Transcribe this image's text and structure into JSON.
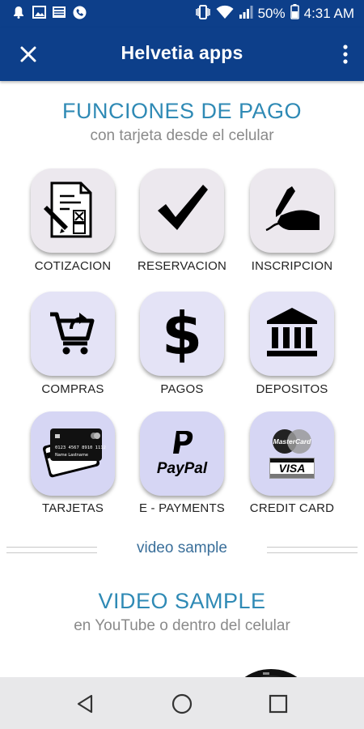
{
  "status_bar": {
    "battery": "50%",
    "time": "4:31 AM",
    "icons": [
      "notification-bell-icon",
      "image-icon",
      "news-icon",
      "phone-icon",
      "vibrate-icon",
      "wifi-icon",
      "signal-icon",
      "battery-icon"
    ]
  },
  "app_bar": {
    "title": "Helvetia apps",
    "close_icon": "close-icon",
    "menu_icon": "more-vert-icon"
  },
  "section1": {
    "title": "FUNCIONES DE PAGO",
    "subtitle": "con tarjeta desde el celular"
  },
  "tiles": [
    {
      "label": "COTIZACION",
      "icon": "quote-document-icon"
    },
    {
      "label": "RESERVACION",
      "icon": "checkmark-icon"
    },
    {
      "label": "INSCRIPCION",
      "icon": "signature-hand-icon"
    },
    {
      "label": "COMPRAS",
      "icon": "shopping-cart-icon"
    },
    {
      "label": "PAGOS",
      "icon": "dollar-icon"
    },
    {
      "label": "DEPOSITOS",
      "icon": "bank-icon"
    },
    {
      "label": "TARJETAS",
      "icon": "credit-cards-icon",
      "card_number": "0123 4567 8910 1112",
      "card_name": "Name Lastname"
    },
    {
      "label": "E - PAYMENTS",
      "icon": "paypal-icon",
      "brand": "PayPal"
    },
    {
      "label": "CREDIT CARD",
      "icon": "mastercard-visa-icon",
      "brands": [
        "MasterCard",
        "VISA"
      ]
    }
  ],
  "separator": {
    "label": "video sample"
  },
  "section2": {
    "title": "VIDEO SAMPLE",
    "subtitle": "en YouTube o dentro del celular"
  },
  "nav_bar": {
    "back": "back-icon",
    "home": "home-icon",
    "recents": "recents-icon"
  },
  "colors": {
    "primary": "#0d3f8a",
    "heading": "#2f8ab5",
    "subtitle": "#8a8a8a",
    "tile_pink": "#ece8ee",
    "tile_lavender": "#e4e3f6",
    "tile_blue": "#d6d6f4",
    "nav_bar": "#e8e8ea"
  }
}
